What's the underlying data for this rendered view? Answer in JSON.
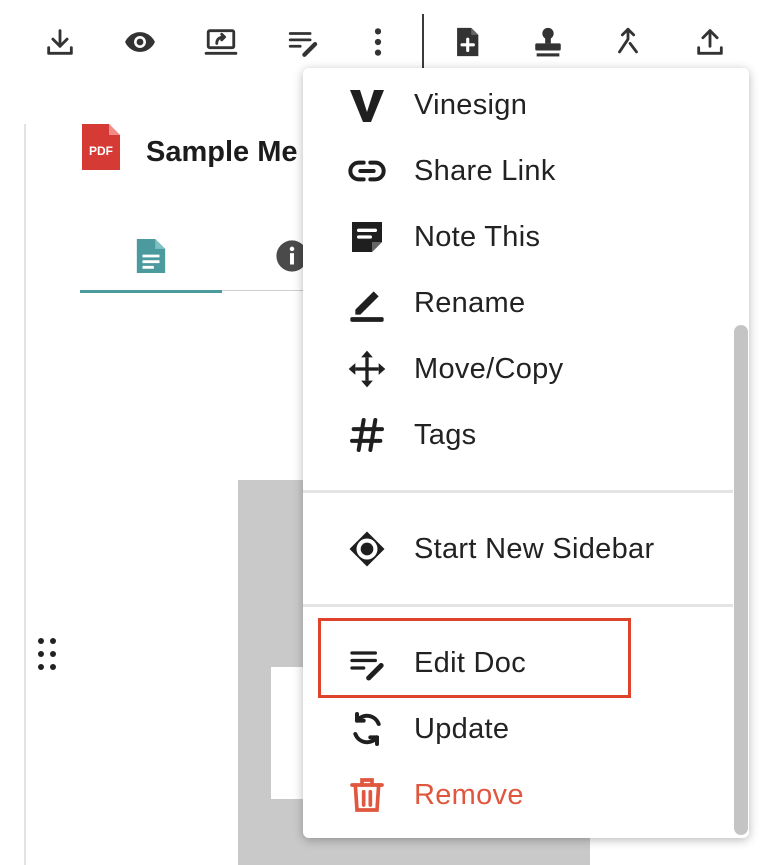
{
  "document": {
    "title": "Sample Me",
    "file_badge": "PDF"
  },
  "toolbar": {
    "buttons": [
      {
        "name": "download",
        "icon": "download-icon"
      },
      {
        "name": "view",
        "icon": "eye-icon"
      },
      {
        "name": "present",
        "icon": "screen-share-icon"
      },
      {
        "name": "edit-doc",
        "icon": "edit-doc-icon"
      },
      {
        "name": "more",
        "icon": "more-vertical-icon"
      },
      {
        "name": "new-file",
        "icon": "file-plus-icon"
      },
      {
        "name": "stamp",
        "icon": "stamp-icon"
      },
      {
        "name": "merge",
        "icon": "merge-icon"
      },
      {
        "name": "upload",
        "icon": "upload-icon"
      }
    ]
  },
  "tabs": [
    {
      "name": "document",
      "icon": "document-icon",
      "active": true
    },
    {
      "name": "info",
      "icon": "info-icon",
      "active": false
    }
  ],
  "menu": {
    "items": [
      {
        "label": "Vinesign",
        "icon": "vinesign-icon"
      },
      {
        "label": "Share Link",
        "icon": "link-icon"
      },
      {
        "label": "Note This",
        "icon": "note-icon"
      },
      {
        "label": "Rename",
        "icon": "pencil-icon"
      },
      {
        "label": "Move/Copy",
        "icon": "move-icon"
      },
      {
        "label": "Tags",
        "icon": "hashtag-icon"
      },
      {
        "label": "Start New Sidebar",
        "icon": "sidebar-icon"
      },
      {
        "label": "Edit Doc",
        "icon": "edit-doc-icon",
        "highlighted": true
      },
      {
        "label": "Update",
        "icon": "refresh-icon"
      },
      {
        "label": "Remove",
        "icon": "trash-icon",
        "danger": true
      }
    ]
  },
  "colors": {
    "accent": "#4a9a9e",
    "danger": "#e0563e",
    "highlight": "#e0432c",
    "pdf_red": "#d63a34"
  }
}
